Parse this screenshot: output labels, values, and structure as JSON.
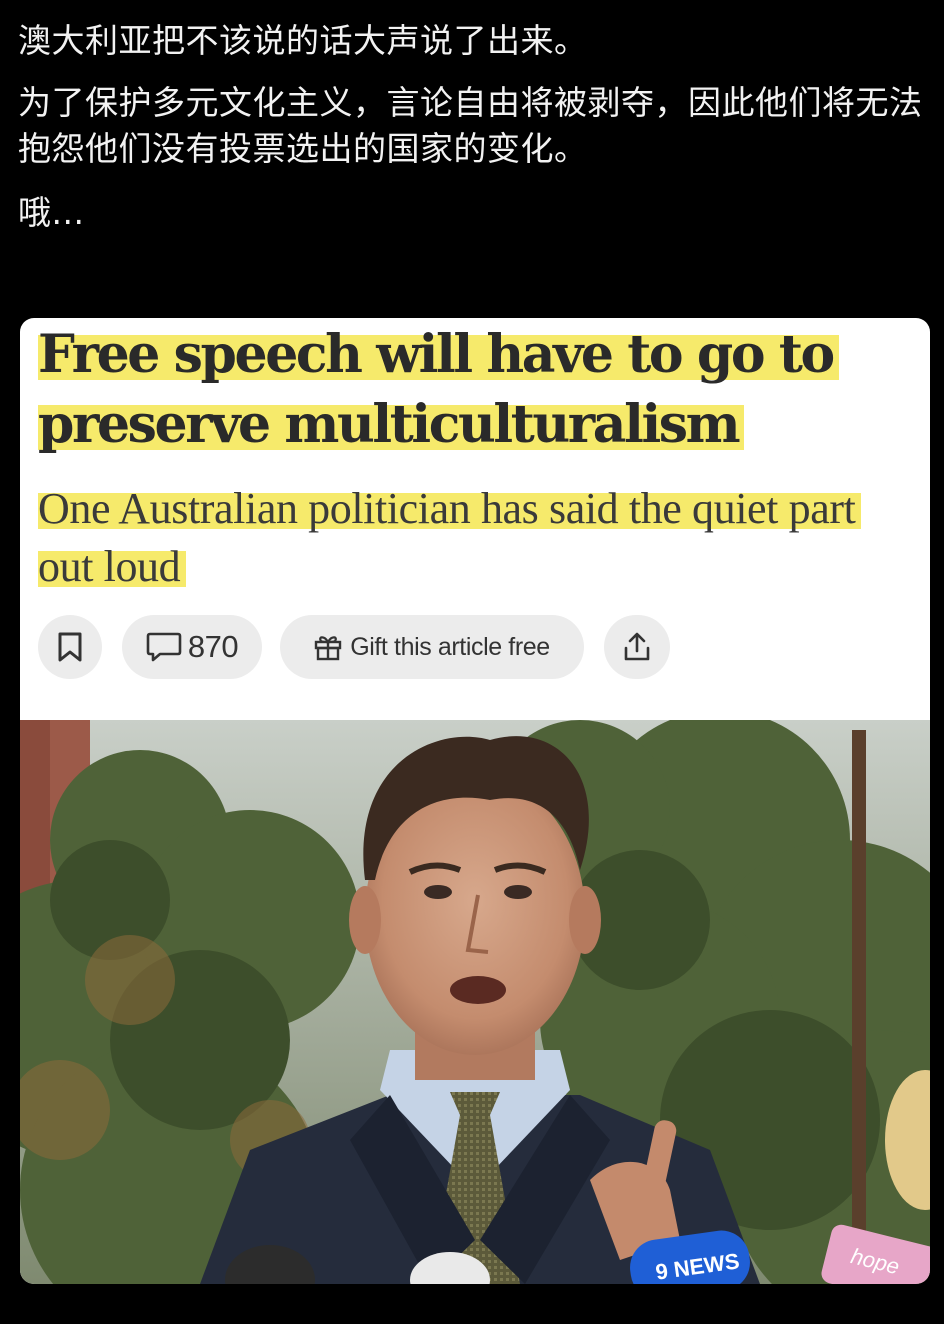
{
  "post": {
    "line1": "澳大利亚把不该说的话大声说了出来。",
    "paragraph2": "为了保护多元文化主义，言论自由将被剥夺，因此他们将无法抱怨他们没有投票选出的国家的变化。",
    "line3": "哦..."
  },
  "article": {
    "headline": "Free speech will have to go to preserve multiculturalism",
    "standfirst": "One Australian politician has said the quiet part out loud",
    "actions": {
      "comment_count": "870",
      "gift_label": "Gift this article free"
    },
    "photo": {
      "mic_logo": "9 NEWS",
      "sign_text": "hope"
    }
  },
  "icons": [
    "bookmark-icon",
    "comment-icon",
    "gift-icon",
    "share-icon"
  ],
  "colors": {
    "background": "#000000",
    "post_text": "#f2f2f2",
    "highlight": "#f6ea6b",
    "pill": "#ececec"
  }
}
